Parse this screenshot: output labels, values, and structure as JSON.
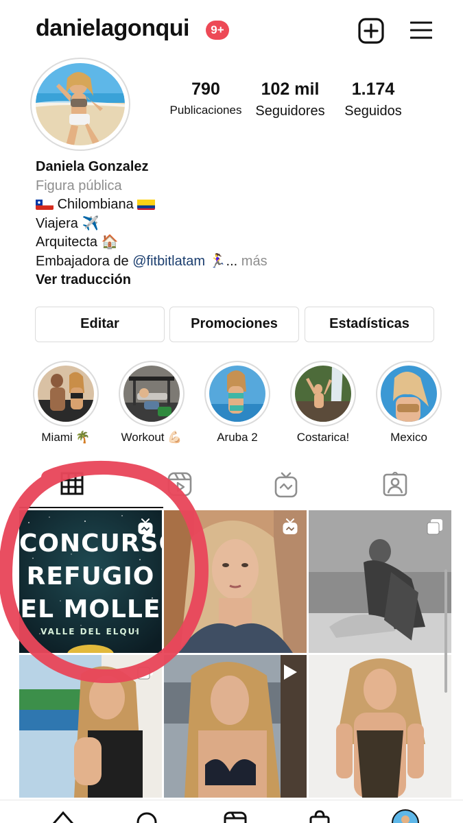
{
  "header": {
    "username": "danielagonqui",
    "notification_badge": "9+",
    "new_post_icon": "plus-square-icon",
    "menu_icon": "hamburger-menu-icon"
  },
  "profile": {
    "stats": [
      {
        "value": "790",
        "label": "Publicaciones"
      },
      {
        "value": "102 mil",
        "label": "Seguidores"
      },
      {
        "value": "1.174",
        "label": "Seguidos"
      }
    ],
    "bio": {
      "name": "Daniela Gonzalez",
      "category": "Figura pública",
      "line1": "Chilombiana",
      "line2": "Viajera ✈️",
      "line3": "Arquitecta 🏠",
      "line4_prefix": "Embajadora de ",
      "line4_mention": "@fitbitlatam",
      "line4_suffix": " 🏃‍♀️... ",
      "more": "más",
      "translate": "Ver traducción"
    }
  },
  "actions": {
    "edit": "Editar",
    "promotions": "Promociones",
    "insights": "Estadísticas"
  },
  "highlights": [
    {
      "label": "Miami 🌴"
    },
    {
      "label": "Workout 💪🏻"
    },
    {
      "label": "Aruba 2"
    },
    {
      "label": "Costarica!"
    },
    {
      "label": "Mexico"
    }
  ],
  "tabs": {
    "active": "grid",
    "items": [
      "grid-icon",
      "reels-icon",
      "igtv-icon",
      "tagged-icon"
    ]
  },
  "grid": {
    "poster": {
      "line1": "CONCURSO",
      "line2": "REFUGIO",
      "line3": "EL MOLLE",
      "sub": "VALLE DEL ELQUI"
    }
  },
  "colors": {
    "badge": "#ed4956",
    "annotation_circle": "#e8475b",
    "mention": "#1a3d6e",
    "muted": "#8e8e8e"
  }
}
